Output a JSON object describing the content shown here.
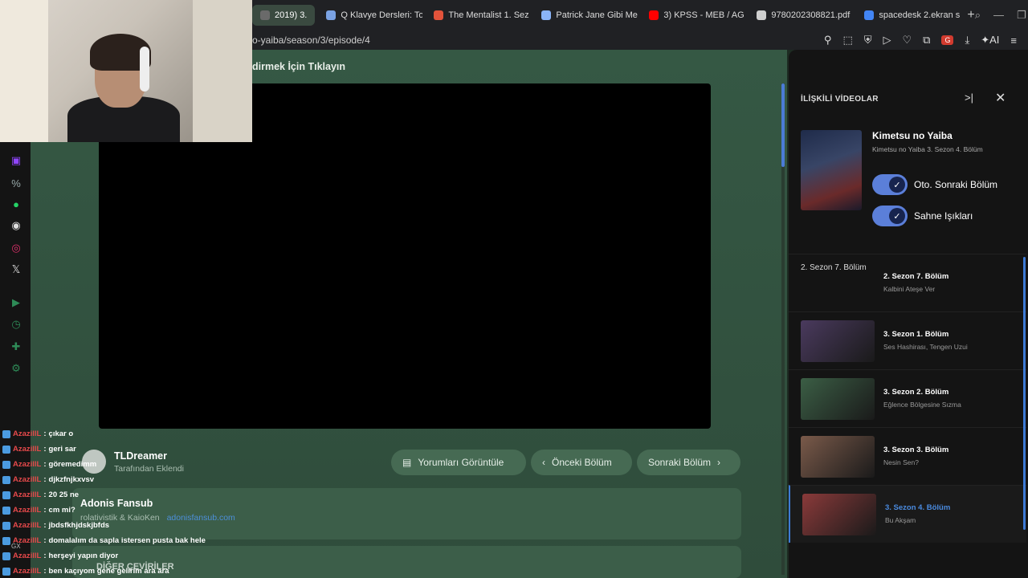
{
  "tabs": [
    {
      "label": "2019) 3.",
      "color": "#6a6a6a",
      "active": true
    },
    {
      "label": "Q Klavye Dersleri: To",
      "color": "#7aa2e3"
    },
    {
      "label": "The Mentalist 1. Sez",
      "color": "#e2533b"
    },
    {
      "label": "Patrick Jane Gibi Me",
      "color": "#8ab4f8"
    },
    {
      "label": "3) KPSS - MEB / AG",
      "color": "#ff0000"
    },
    {
      "label": "9780202308821.pdf",
      "color": "#cfcfcf"
    },
    {
      "label": "spacedesk 2.ekran s",
      "color": "#4285f4"
    }
  ],
  "url": "o-yaiba/season/3/episode/4",
  "banner": "dirmek İçin Tıklayın",
  "uploader": {
    "name": "TLDreamer",
    "subtitle": "Tarafından Eklendi"
  },
  "buttons": {
    "comments": "Yorumları Görüntüle",
    "prev": "Önceki Bölüm",
    "next": "Sonraki Bölüm"
  },
  "fansub": {
    "name": "Adonis Fansub",
    "credits": "rolativistik & KaioKen",
    "link": "adonisfansub.com"
  },
  "other_translations": "DİĞER ÇEVİRİLER",
  "chat": [
    {
      "user": "AzazillL",
      "msg": "çıkar o"
    },
    {
      "user": "AzazillL",
      "msg": "geri sar"
    },
    {
      "user": "AzazillL",
      "msg": "göremedimm"
    },
    {
      "user": "AzazillL",
      "msg": "djkzfnjkxvsv"
    },
    {
      "user": "AzazillL",
      "msg": "20 25 ne"
    },
    {
      "user": "AzazillL",
      "msg": "cm mi?"
    },
    {
      "user": "AzazillL",
      "msg": "jbdsfkhjdskjbfds"
    },
    {
      "user": "AzazillL",
      "msg": "domalalım da sapla istersen pusta bak hele"
    },
    {
      "user": "AzazillL",
      "msg": "herşeyi yapın diyor"
    },
    {
      "user": "AzazillL",
      "msg": "ben kaçıyom gene gelirim ara ara"
    }
  ],
  "gx_label": "GX",
  "panel": {
    "title": "İLİŞKİLİ VİDEOLAR",
    "featured_title": "Kimetsu no Yaiba",
    "featured_sub": "Kimetsu no Yaiba 3. Sezon 4. Bölüm",
    "toggle_autonext": "Oto. Sonraki Bölüm",
    "toggle_lights": "Sahne Işıkları"
  },
  "episodes": [
    {
      "title": "2. Sezon 7. Bölüm",
      "sub": "Kalbini Ateşe Ver",
      "thumb_alt": "2. Sezon 7. Bölüm",
      "color": "",
      "active": false
    },
    {
      "title": "3. Sezon 1. Bölüm",
      "sub": "Ses Hashirası, Tengen Uzui",
      "thumb_alt": "",
      "color": "#4a3a5e",
      "active": false
    },
    {
      "title": "3. Sezon 2. Bölüm",
      "sub": "Eğlence Bölgesine Sızma",
      "thumb_alt": "",
      "color": "#3b5e45",
      "active": false
    },
    {
      "title": "3. Sezon 3. Bölüm",
      "sub": "Nesin Sen?",
      "thumb_alt": "",
      "color": "#7a5a4a",
      "active": false
    },
    {
      "title": "3. Sezon 4. Bölüm",
      "sub": "Bu Akşam",
      "thumb_alt": "",
      "color": "#8a3a3a",
      "active": true
    }
  ],
  "colors": {
    "accent": "#5b7fd9",
    "page_bg": "#355844",
    "chat_user": "#e6494b"
  }
}
